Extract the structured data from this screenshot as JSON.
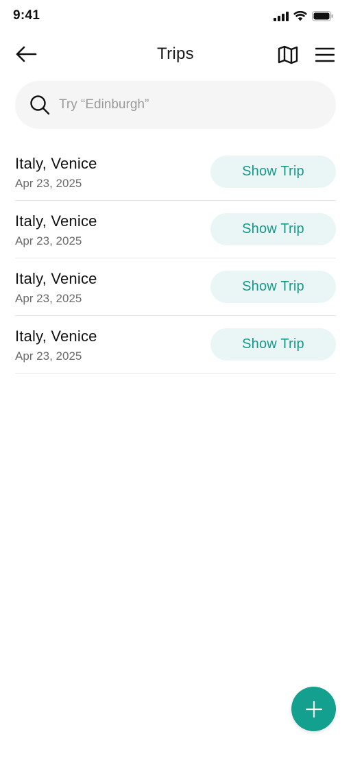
{
  "status_bar": {
    "time": "9:41",
    "icons": [
      "signal-icon",
      "wifi-icon",
      "battery-icon"
    ]
  },
  "header": {
    "title": "Trips",
    "back_icon": "arrow-left-icon",
    "map_icon": "map-icon",
    "menu_icon": "hamburger-menu-icon"
  },
  "search": {
    "placeholder": "Try “Edinburgh”",
    "value": "",
    "icon": "search-icon"
  },
  "trips": [
    {
      "name": "Italy, Venice",
      "date": "Apr 23, 2025",
      "button_label": "Show Trip"
    },
    {
      "name": "Italy, Venice",
      "date": "Apr 23, 2025",
      "button_label": "Show Trip"
    },
    {
      "name": "Italy, Venice",
      "date": "Apr 23, 2025",
      "button_label": "Show Trip"
    },
    {
      "name": "Italy, Venice",
      "date": "Apr 23, 2025",
      "button_label": "Show Trip"
    }
  ],
  "fab": {
    "icon": "plus-icon"
  },
  "colors": {
    "accent": "#14a08f",
    "accent_text": "#139a8a",
    "button_bg": "#eaf6f5",
    "search_bg": "#f5f5f5"
  }
}
